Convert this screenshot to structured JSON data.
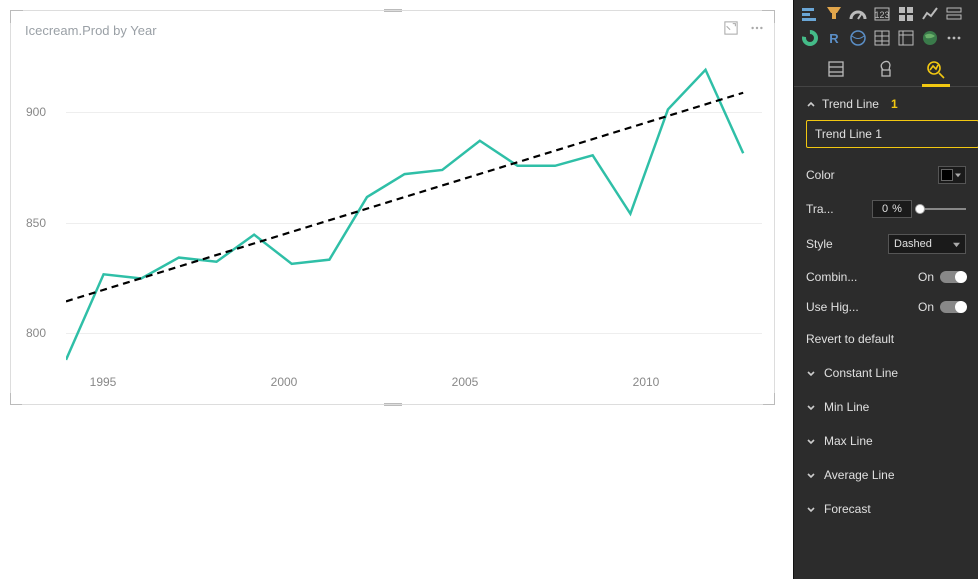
{
  "chart": {
    "title": "Icecream.Prod by Year"
  },
  "chart_data": {
    "type": "line",
    "title": "Icecream.Prod by Year",
    "xlabel": "",
    "ylabel": "",
    "x_ticks": [
      1995,
      2000,
      2005,
      2010
    ],
    "y_ticks": [
      800,
      850,
      900
    ],
    "ylim": [
      775,
      925
    ],
    "xlim": [
      1994,
      2012.5
    ],
    "series": [
      {
        "name": "Icecream.Prod",
        "x": [
          1994,
          1995,
          1996,
          1997,
          1998,
          1999,
          2000,
          2001,
          2002,
          2003,
          2004,
          2005,
          2006,
          2007,
          2008,
          2009,
          2010,
          2011,
          2012
        ],
        "values": [
          777,
          818,
          816,
          826,
          824,
          837,
          823,
          825,
          855,
          866,
          868,
          882,
          870,
          870,
          875,
          847,
          897,
          916,
          876
        ]
      }
    ],
    "trend_line": {
      "x": [
        1994,
        2012
      ],
      "y": [
        805,
        905
      ],
      "style": "dashed",
      "color": "#000"
    }
  },
  "panel": {
    "header": {
      "label": "Trend Line",
      "count": "1"
    },
    "name_input": {
      "value": "Trend Line 1"
    },
    "props": {
      "color_label": "Color",
      "transparency_label": "Tra...",
      "transparency_value": "0",
      "transparency_unit": "%",
      "style_label": "Style",
      "style_value": "Dashed",
      "combine_label": "Combin...",
      "combine_value": "On",
      "highlight_label": "Use Hig...",
      "highlight_value": "On",
      "revert_label": "Revert to default"
    },
    "sections": {
      "constant": "Constant Line",
      "min": "Min Line",
      "max": "Max Line",
      "average": "Average Line",
      "forecast": "Forecast"
    }
  }
}
